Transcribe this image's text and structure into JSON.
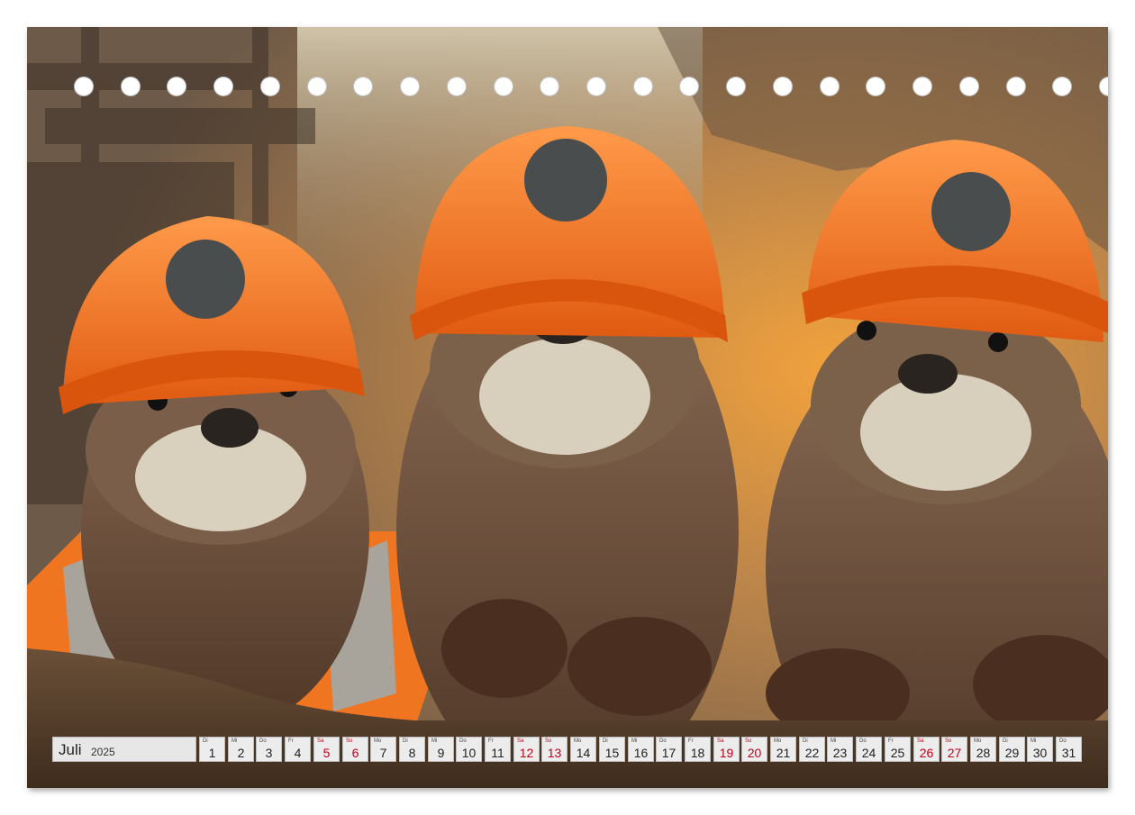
{
  "calendar": {
    "month": "Juli",
    "year": "2025",
    "weekend_color": "#c0001a",
    "days": [
      {
        "dow": "Di",
        "num": "1",
        "weekend": false
      },
      {
        "dow": "Mi",
        "num": "2",
        "weekend": false
      },
      {
        "dow": "Do",
        "num": "3",
        "weekend": false
      },
      {
        "dow": "Fr",
        "num": "4",
        "weekend": false
      },
      {
        "dow": "Sa",
        "num": "5",
        "weekend": true
      },
      {
        "dow": "So",
        "num": "6",
        "weekend": true
      },
      {
        "dow": "Mo",
        "num": "7",
        "weekend": false
      },
      {
        "dow": "Di",
        "num": "8",
        "weekend": false
      },
      {
        "dow": "Mi",
        "num": "9",
        "weekend": false
      },
      {
        "dow": "Do",
        "num": "10",
        "weekend": false
      },
      {
        "dow": "Fr",
        "num": "11",
        "weekend": false
      },
      {
        "dow": "Sa",
        "num": "12",
        "weekend": true
      },
      {
        "dow": "So",
        "num": "13",
        "weekend": true
      },
      {
        "dow": "Mo",
        "num": "14",
        "weekend": false
      },
      {
        "dow": "Di",
        "num": "15",
        "weekend": false
      },
      {
        "dow": "Mi",
        "num": "16",
        "weekend": false
      },
      {
        "dow": "Do",
        "num": "17",
        "weekend": false
      },
      {
        "dow": "Fr",
        "num": "18",
        "weekend": false
      },
      {
        "dow": "Sa",
        "num": "19",
        "weekend": true
      },
      {
        "dow": "So",
        "num": "20",
        "weekend": true
      },
      {
        "dow": "Mo",
        "num": "21",
        "weekend": false
      },
      {
        "dow": "Di",
        "num": "22",
        "weekend": false
      },
      {
        "dow": "Mi",
        "num": "23",
        "weekend": false
      },
      {
        "dow": "Do",
        "num": "24",
        "weekend": false
      },
      {
        "dow": "Fr",
        "num": "25",
        "weekend": false
      },
      {
        "dow": "Sa",
        "num": "26",
        "weekend": true
      },
      {
        "dow": "So",
        "num": "27",
        "weekend": true
      },
      {
        "dow": "Mo",
        "num": "28",
        "weekend": false
      },
      {
        "dow": "Di",
        "num": "29",
        "weekend": false
      },
      {
        "dow": "Mi",
        "num": "30",
        "weekend": false
      },
      {
        "dow": "Do",
        "num": "31",
        "weekend": false
      }
    ]
  },
  "photo": {
    "subject": "three-otters-in-orange-hard-hats",
    "helmet_color": "#f2701c",
    "fur_color": "#6b4a33"
  }
}
